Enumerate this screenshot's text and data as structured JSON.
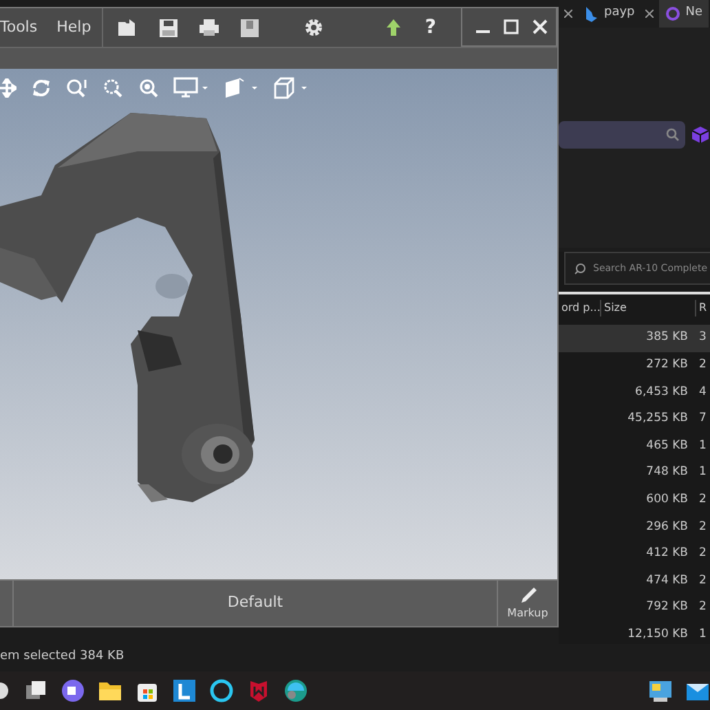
{
  "viewer": {
    "menu": [
      {
        "label": "Tools"
      },
      {
        "label": "Help"
      }
    ],
    "help_label": "?",
    "view_name": "Default",
    "markup_label": "Markup"
  },
  "browser": {
    "tabs": [
      {
        "label": "payp",
        "selected": false
      },
      {
        "label": "Ne",
        "selected": true
      }
    ]
  },
  "explorer": {
    "search_placeholder": "Search AR-10 Complete",
    "columns": [
      "ord p...",
      "Size",
      "R"
    ],
    "rows": [
      {
        "size": "385 KB",
        "column_3": "3",
        "selected": true
      },
      {
        "size": "272 KB",
        "column_3": "2",
        "selected": false
      },
      {
        "size": "6,453 KB",
        "column_3": "4",
        "selected": false
      },
      {
        "size": "45,255 KB",
        "column_3": "7",
        "selected": false
      },
      {
        "size": "465 KB",
        "column_3": "1",
        "selected": false
      },
      {
        "size": "748 KB",
        "column_3": "1",
        "selected": false
      },
      {
        "size": "600 KB",
        "column_3": "2",
        "selected": false
      },
      {
        "size": "296 KB",
        "column_3": "2",
        "selected": false
      },
      {
        "size": "412 KB",
        "column_3": "2",
        "selected": false
      },
      {
        "size": "474 KB",
        "column_3": "2",
        "selected": false
      },
      {
        "size": "792 KB",
        "column_3": "2",
        "selected": false
      },
      {
        "size": "12,150 KB",
        "column_3": "1",
        "selected": false
      }
    ],
    "status": "em selected  384 KB"
  }
}
